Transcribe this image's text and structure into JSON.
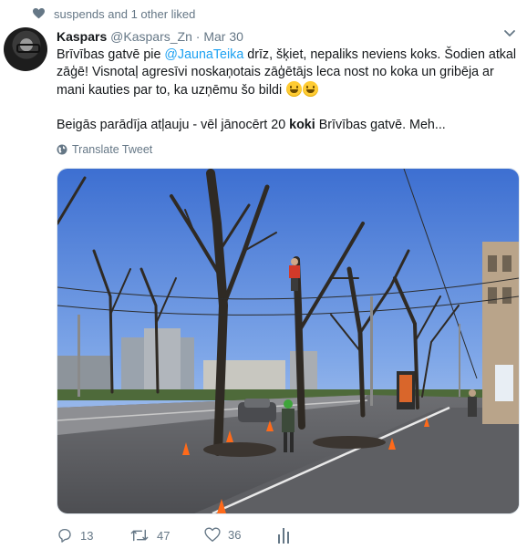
{
  "social_context": {
    "text": "suspends and 1 other liked"
  },
  "tweet": {
    "author_name": "Kaspars",
    "author_handle": "@Kaspars_Zn",
    "separator": "·",
    "date": "Mar 30",
    "line1_pre": "Brīvības gatvē pie ",
    "mention": "@JaunaTeika",
    "line1_post": " drīz, šķiet, nepaliks neviens koks. Šodien atkal zāģē! Visnotaļ agresīvi noskaņotais zāģētājs leca nost no koka un gribēja ar mani kauties par to, ka uzņēmu šo bildi",
    "line2_pre": "Beigās parādīja atļauju - vēl jānocērt 20 ",
    "line2_bold": "koki",
    "line2_post": " Brīvības gatvē. Meh...",
    "translate_label": "Translate Tweet"
  },
  "actions": {
    "reply_count": "13",
    "retweet_count": "47",
    "like_count": "36"
  },
  "icons": {
    "liked": "heart-icon",
    "more": "chevron-down-icon",
    "translate": "globe-icon",
    "reply": "reply-icon",
    "retweet": "retweet-icon",
    "like": "heart-outline-icon",
    "analytics": "analytics-icon"
  },
  "colors": {
    "accent": "#1da1f2",
    "muted": "#657786",
    "text": "#14171a"
  }
}
